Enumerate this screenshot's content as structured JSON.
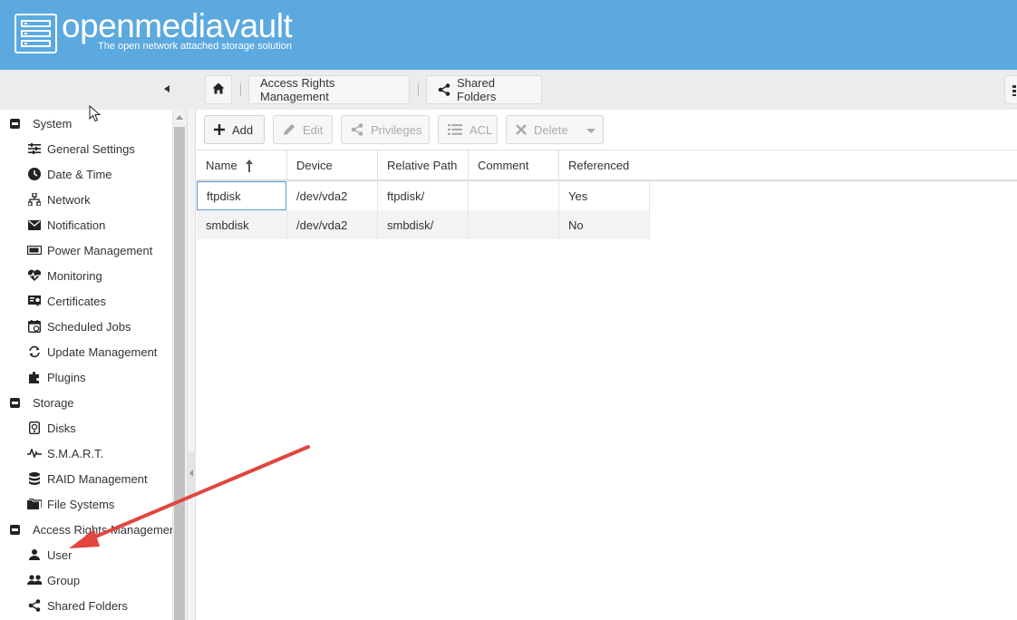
{
  "header": {
    "brand": "openmediavault",
    "tagline": "The open network attached storage solution"
  },
  "breadcrumb": {
    "home_icon": "home-icon",
    "items": [
      {
        "label": "Access Rights Management"
      },
      {
        "label": "Shared Folders",
        "icon": "share-icon"
      }
    ]
  },
  "toolbar": {
    "add": "Add",
    "edit": "Edit",
    "privileges": "Privileges",
    "acl": "ACL",
    "delete": "Delete"
  },
  "grid": {
    "columns": [
      "Name",
      "Device",
      "Relative Path",
      "Comment",
      "Referenced"
    ],
    "sort_column": "Name",
    "sort_direction": "ascending",
    "rows": [
      {
        "name": "ftpdisk",
        "device": "/dev/vda2",
        "path": "ftpdisk/",
        "comment": "",
        "referenced": "Yes"
      },
      {
        "name": "smbdisk",
        "device": "/dev/vda2",
        "path": "smbdisk/",
        "comment": "",
        "referenced": "No"
      }
    ]
  },
  "nav": {
    "system": {
      "label": "System",
      "items": [
        "General Settings",
        "Date & Time",
        "Network",
        "Notification",
        "Power Management",
        "Monitoring",
        "Certificates",
        "Scheduled Jobs",
        "Update Management",
        "Plugins"
      ]
    },
    "storage": {
      "label": "Storage",
      "items": [
        "Disks",
        "S.M.A.R.T.",
        "RAID Management",
        "File Systems"
      ]
    },
    "access": {
      "label": "Access Rights Management",
      "items": [
        "User",
        "Group",
        "Shared Folders"
      ]
    }
  },
  "colors": {
    "header_bg": "#5ba9df",
    "annotation_arrow": "#e0463f"
  }
}
